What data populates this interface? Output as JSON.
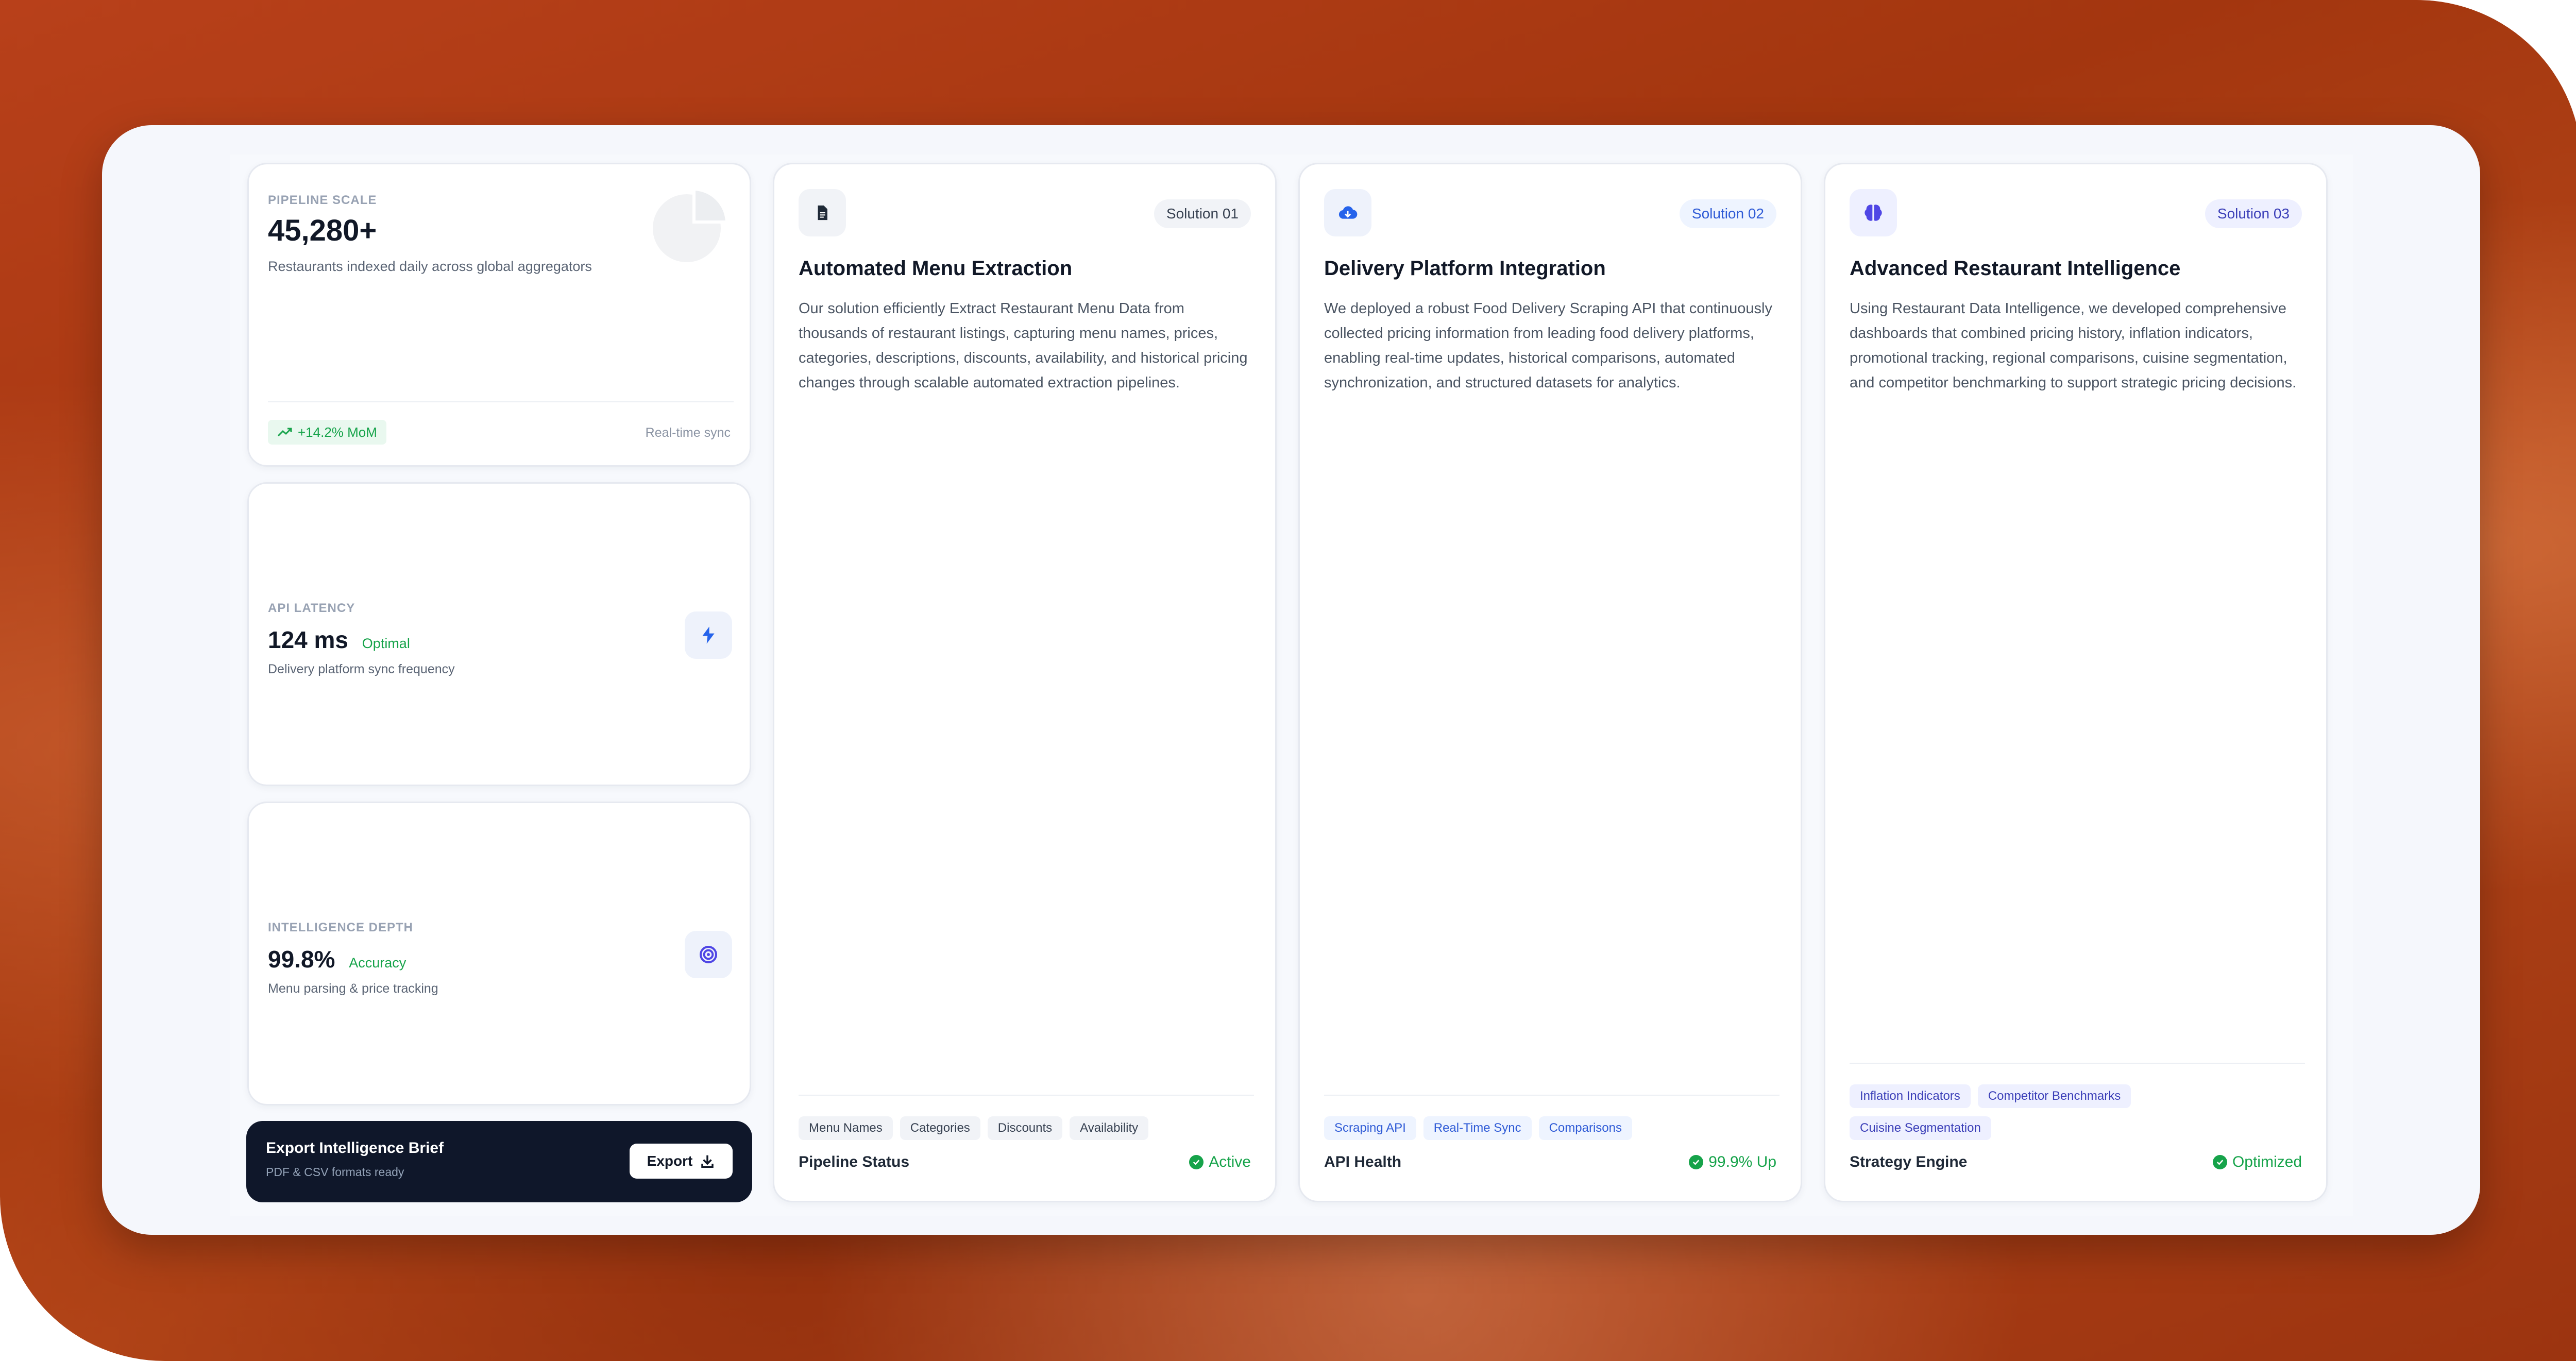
{
  "stats": {
    "pipeline": {
      "kicker": "PIPELINE SCALE",
      "value": "45,280+",
      "description": "Restaurants indexed daily across global aggregators",
      "growth": "+14.2% MoM",
      "sync": "Real-time sync",
      "icon": "pie-chart-icon"
    },
    "latency": {
      "kicker": "API LATENCY",
      "value": "124 ms",
      "status": "Optimal",
      "description": "Delivery platform sync frequency",
      "icon": "lightning-icon"
    },
    "depth": {
      "kicker": "INTELLIGENCE DEPTH",
      "value": "99.8%",
      "status": "Accuracy",
      "description": "Menu parsing & price tracking",
      "icon": "target-icon"
    }
  },
  "export": {
    "title": "Export Intelligence Brief",
    "subtitle": "PDF & CSV formats ready",
    "button": "Export"
  },
  "solutions": [
    {
      "badge": "Solution 01",
      "title": "Automated Menu Extraction",
      "description": "Our solution efficiently Extract Restaurant Menu Data from thousands of restaurant listings, capturing menu names, prices, categories, descriptions, discounts, availability, and historical pricing changes through scalable automated extraction pipelines.",
      "tags": [
        "Menu Names",
        "Categories",
        "Discounts",
        "Availability"
      ],
      "footer_label": "Pipeline Status",
      "footer_status": "Active",
      "icon": "document-icon"
    },
    {
      "badge": "Solution 02",
      "title": "Delivery Platform Integration",
      "description": "We deployed a robust Food Delivery Scraping API that continuously collected pricing information from leading food delivery platforms, enabling real-time updates, historical comparisons, automated synchronization, and structured datasets for analytics.",
      "tags": [
        "Scraping API",
        "Real-Time Sync",
        "Comparisons"
      ],
      "footer_label": "API Health",
      "footer_status": "99.9% Up",
      "icon": "cloud-download-icon"
    },
    {
      "badge": "Solution 03",
      "title": "Advanced Restaurant Intelligence",
      "description": "Using Restaurant Data Intelligence, we developed comprehensive dashboards that combined pricing history, inflation indicators, promotional tracking, regional comparisons, cuisine segmentation, and competitor benchmarking to support strategic pricing decisions.",
      "tags": [
        "Inflation Indicators",
        "Competitor Benchmarks",
        "Cuisine Segmentation"
      ],
      "footer_label": "Strategy Engine",
      "footer_status": "Optimized",
      "icon": "brain-icon"
    }
  ],
  "colors": {
    "background": "#a3360f",
    "accent_green": "#16a34a",
    "dark_card": "#0f172a"
  }
}
